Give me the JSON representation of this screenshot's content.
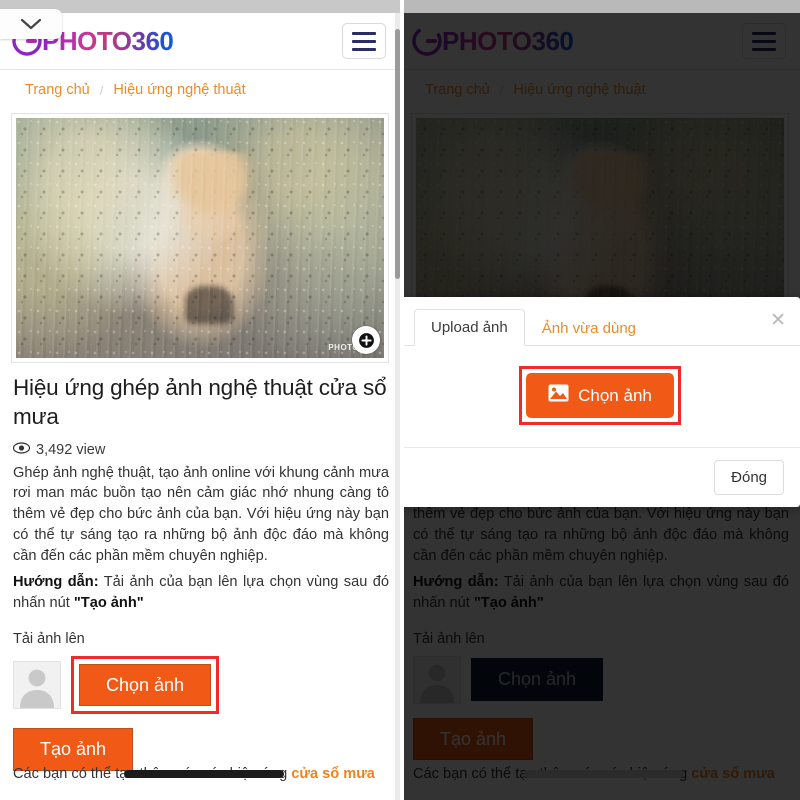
{
  "site": {
    "logo_text": "PHOTO360",
    "logo_icon": "photo360-circle-logo",
    "menu_icon": "hamburger-menu-icon",
    "chevron_icon": "chevron-down-icon"
  },
  "breadcrumb": {
    "home": "Trang chủ",
    "separator": "/",
    "current": "Hiệu ứng nghệ thuật"
  },
  "hero": {
    "alt": "rain-window-portrait",
    "watermark": "PHOTO360",
    "zoom_icon": "zoom-in-icon"
  },
  "article": {
    "title": "Hiệu ứng ghép ảnh nghệ thuật cửa sổ mưa",
    "views_icon": "eye-icon",
    "views": "3,492 view",
    "paragraph": "Ghép ảnh nghệ thuật, tạo ảnh online với khung cảnh mưa rơi man mác buồn tạo nên cảm giác nhớ nhung càng tô thêm vẻ đẹp cho bức ảnh của bạn. Với hiệu ứng này bạn có thể tự sáng tạo ra những bộ ảnh độc đáo mà không cần đến các phần mềm chuyên nghiệp.",
    "guide_label": "Hướng dẫn:",
    "guide_text": " Tải ảnh của bạn lên lựa chọn vùng sau đó nhấn nút ",
    "guide_button_ref": "\"Tạo ảnh\"",
    "upload_label": "Tải ảnh lên",
    "avatar_icon": "person-placeholder-icon",
    "choose_button": "Chọn ảnh",
    "create_button": "Tạo ảnh",
    "footer_text_before": "Các bạn có thể tạo thêm các các hiệu ứng ",
    "footer_link": "cửa sổ mưa"
  },
  "modal": {
    "tabs": [
      {
        "label": "Upload ảnh",
        "active": true
      },
      {
        "label": "Ảnh vừa dùng",
        "active": false
      }
    ],
    "close_icon": "close-icon",
    "pick_icon": "image-icon",
    "pick_button": "Chọn ảnh",
    "close_button": "Đóng"
  },
  "colors": {
    "accent_orange": "#f05a16",
    "link_orange": "#f08a24",
    "highlight_red": "#ef2b2b",
    "focused_button": "#0b1b33"
  }
}
